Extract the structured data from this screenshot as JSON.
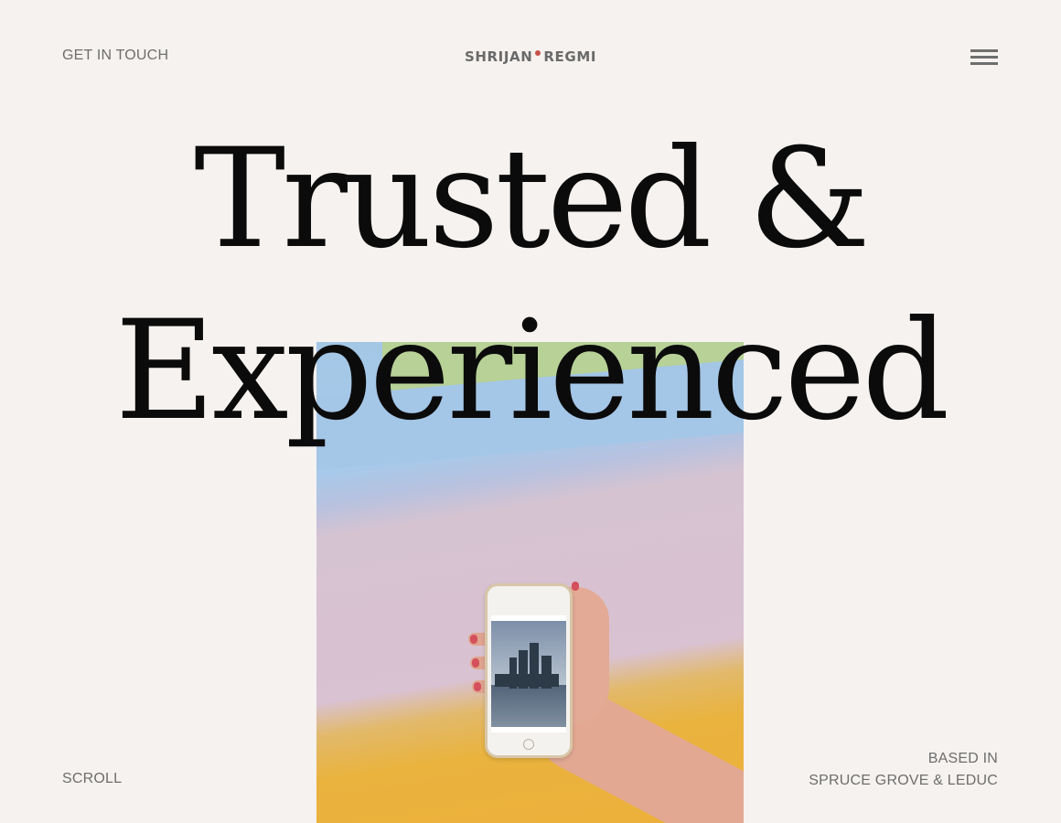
{
  "header": {
    "contact_label": "GET IN TOUCH",
    "logo_first": "SHRIJAN",
    "logo_last": "REGMI",
    "menu_icon": "hamburger-menu-icon"
  },
  "hero": {
    "headline_line1": "Trusted &",
    "headline_line2": "Experienced",
    "image_description_icon": "hand-holding-phone-photo"
  },
  "footer": {
    "scroll_label": "SCROLL",
    "location_line1": "BASED IN",
    "location_line2": "SPRUCE GROVE & LEDUC"
  },
  "colors": {
    "background": "#f5f2ef",
    "text_muted": "#6e6e6e",
    "headline": "#0b0b0b",
    "logo_dot": "#c8524b"
  }
}
